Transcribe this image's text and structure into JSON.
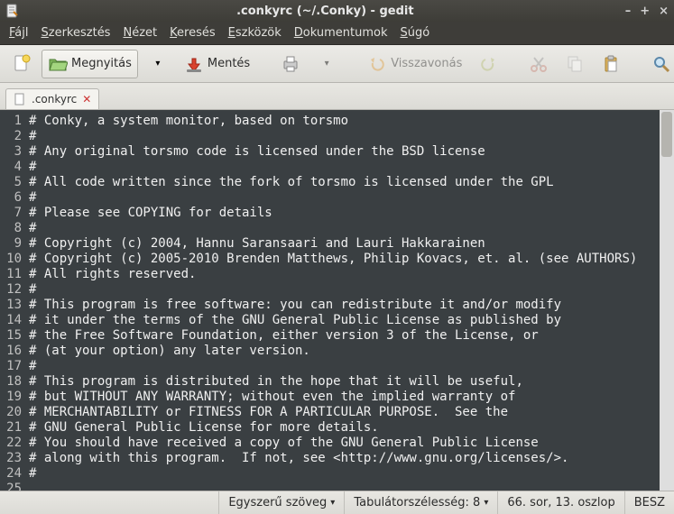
{
  "window": {
    "title": ".conkyrc (~/.Conky) - gedit"
  },
  "menubar": [
    "Fájl",
    "Szerkesztés",
    "Nézet",
    "Keresés",
    "Eszközök",
    "Dokumentumok",
    "Súgó"
  ],
  "toolbar": {
    "open_label": "Megnyitás",
    "save_label": "Mentés",
    "undo_label": "Visszavonás"
  },
  "tab": {
    "label": ".conkyrc"
  },
  "editor": {
    "lines": [
      "# Conky, a system monitor, based on torsmo",
      "#",
      "# Any original torsmo code is licensed under the BSD license",
      "#",
      "# All code written since the fork of torsmo is licensed under the GPL",
      "#",
      "# Please see COPYING for details",
      "#",
      "# Copyright (c) 2004, Hannu Saransaari and Lauri Hakkarainen",
      "# Copyright (c) 2005-2010 Brenden Matthews, Philip Kovacs, et. al. (see AUTHORS)",
      "# All rights reserved.",
      "#",
      "# This program is free software: you can redistribute it and/or modify",
      "# it under the terms of the GNU General Public License as published by",
      "# the Free Software Foundation, either version 3 of the License, or",
      "# (at your option) any later version.",
      "#",
      "# This program is distributed in the hope that it will be useful,",
      "# but WITHOUT ANY WARRANTY; without even the implied warranty of",
      "# MERCHANTABILITY or FITNESS FOR A PARTICULAR PURPOSE.  See the",
      "# GNU General Public License for more details.",
      "# You should have received a copy of the GNU General Public License",
      "# along with this program.  If not, see <http://www.gnu.org/licenses/>.",
      "#",
      ""
    ]
  },
  "statusbar": {
    "highlight": "Egyszerű szöveg",
    "tab_width": "Tabulátorszélesség: 8",
    "position": "66. sor, 13. oszlop",
    "insert_mode": "BESZ"
  }
}
